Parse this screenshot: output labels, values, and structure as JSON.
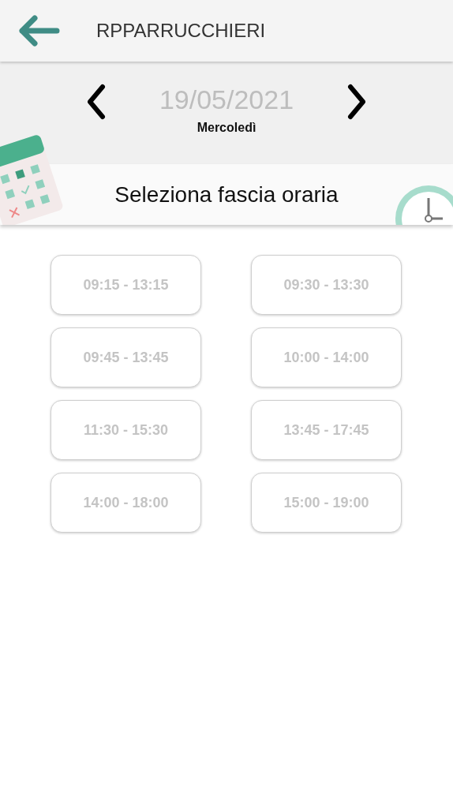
{
  "header": {
    "title": "RPPARRUCCHIERI"
  },
  "date_nav": {
    "date": "19/05/2021",
    "weekday": "Mercoledì"
  },
  "banner": {
    "title": "Seleziona fascia oraria"
  },
  "time_slots": [
    {
      "label": "09:15 - 13:15"
    },
    {
      "label": "09:30 - 13:30"
    },
    {
      "label": "09:45 - 13:45"
    },
    {
      "label": "10:00 - 14:00"
    },
    {
      "label": "11:30 - 15:30"
    },
    {
      "label": "13:45 - 17:45"
    },
    {
      "label": "14:00 - 18:00"
    },
    {
      "label": "15:00 - 19:00"
    }
  ]
}
